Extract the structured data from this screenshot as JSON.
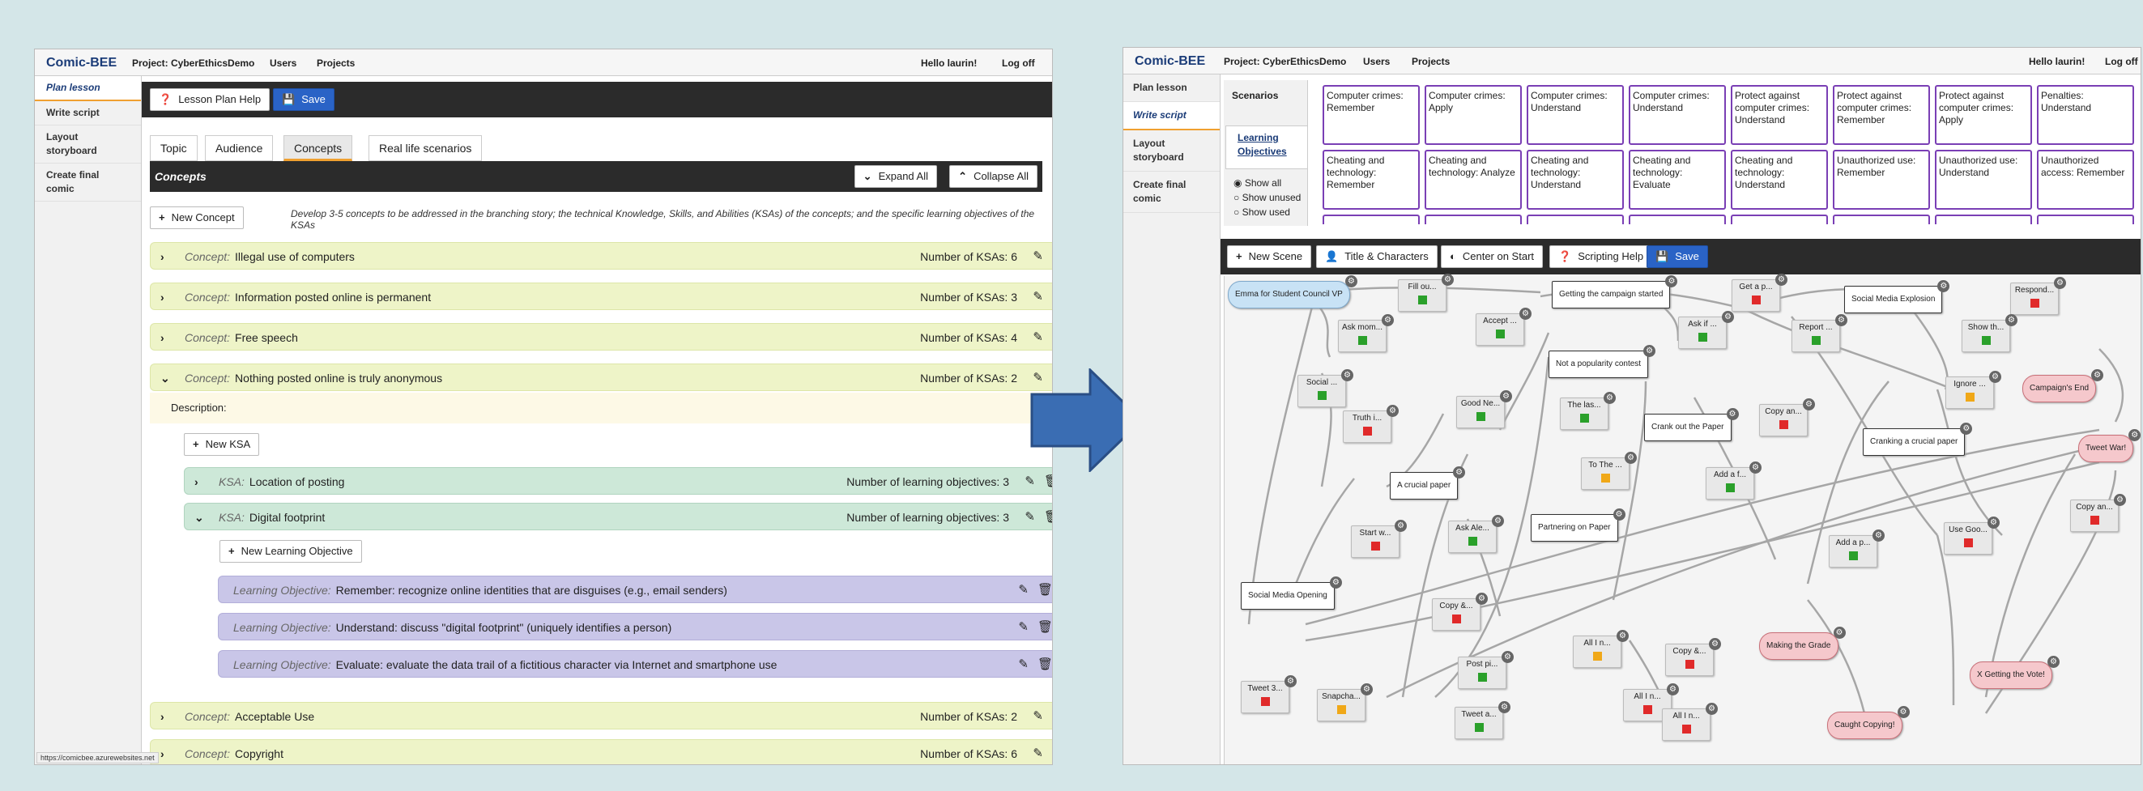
{
  "colors": {
    "accent": "#2a63c6",
    "concept_row": "#eef4c8",
    "ksa_row": "#cde8d8",
    "lo_row": "#c9c6e8",
    "lo_border": "#7a3fb5",
    "end_node": "#f5c8cc",
    "start_node": "#c8e2f5"
  },
  "left": {
    "brand": "Comic-BEE",
    "project": "Project: CyberEthicsDemo",
    "users": "Users",
    "projects": "Projects",
    "hello": "Hello laurin!",
    "logoff": "Log off",
    "sidebar": [
      "Plan lesson",
      "Write script",
      "Layout storyboard",
      "Create final comic"
    ],
    "help_btn": "Lesson Plan Help",
    "save_btn": "Save",
    "tabs": [
      "Topic",
      "Audience",
      "Concepts",
      "Real life scenarios"
    ],
    "section_title": "Concepts",
    "expand_all": "Expand All",
    "collapse_all": "Collapse All",
    "new_concept": "New Concept",
    "instructions": "Develop 3-5 concepts to be addressed in the branching story; the technical Knowledge, Skills, and Abilities (KSAs) of the concepts; and the specific learning objectives of the KSAs",
    "concept_kind": "Concept:",
    "ksa_kind": "KSA:",
    "lo_kind": "Learning Objective:",
    "concepts": [
      {
        "name": "Illegal use of computers",
        "count": "Number of KSAs: 6"
      },
      {
        "name": "Information posted online is permanent",
        "count": "Number of KSAs: 3"
      },
      {
        "name": "Free speech",
        "count": "Number of KSAs: 4"
      },
      {
        "name": "Nothing posted online is truly anonymous",
        "count": "Number of KSAs: 2"
      },
      {
        "name": "Acceptable Use",
        "count": "Number of KSAs: 2"
      },
      {
        "name": "Copyright",
        "count": "Number of KSAs: 6"
      }
    ],
    "description_label": "Description:",
    "new_ksa": "New KSA",
    "ksas": [
      {
        "name": "Location of posting",
        "count": "Number of learning objectives: 3"
      },
      {
        "name": "Digital footprint",
        "count": "Number of learning objectives: 3"
      }
    ],
    "new_lo": "New Learning Objective",
    "objectives": [
      "Remember: recognize online identities that are disguises (e.g., email senders)",
      "Understand: discuss \"digital footprint\" (uniquely identifies a person)",
      "Evaluate: evaluate the data trail of a fictitious character via Internet and smartphone use"
    ],
    "status_url": "https://comicbee.azurewebsites.net"
  },
  "right": {
    "brand": "Comic-BEE",
    "project": "Project: CyberEthicsDemo",
    "users": "Users",
    "projects": "Projects",
    "hello": "Hello laurin!",
    "logoff": "Log off",
    "sidebar": [
      "Plan lesson",
      "Write script",
      "Layout storyboard",
      "Create final comic"
    ],
    "scenarios": "Scenarios",
    "lo_tab": "Learning Objectives",
    "radios": [
      "Show all",
      "Show unused",
      "Show used"
    ],
    "lo_cells_row1": [
      "Computer crimes: Remember",
      "Computer crimes: Apply",
      "Computer crimes: Understand",
      "Computer crimes: Understand",
      "Protect against computer crimes: Understand",
      "Protect against computer crimes: Remember",
      "Protect against computer crimes: Apply",
      "Penalties: Understand"
    ],
    "lo_cells_row2": [
      "Cheating and technology: Remember",
      "Cheating and technology: Analyze",
      "Cheating and technology: Understand",
      "Cheating and technology: Evaluate",
      "Cheating and technology: Understand",
      "Unauthorized use: Remember",
      "Unauthorized use: Understand",
      "Unauthorized access: Remember"
    ],
    "toolbar": {
      "new_scene": "New Scene",
      "title_chars": "Title & Characters",
      "center": "Center on Start",
      "help": "Scripting Help",
      "save": "Save"
    },
    "scenes": {
      "start": "Emma for Student Council VP",
      "campaign": "Getting the campaign started",
      "explosion": "Social Media Explosion",
      "contest": "Not a popularity contest",
      "crank": "Crank out the Paper",
      "cranking": "Cranking a crucial paper",
      "crucial": "A crucial paper",
      "partner": "Partnering on Paper",
      "opening": "Social Media Opening",
      "end1": "Campaign's End",
      "end2": "Tweet War!",
      "end3": "Making the Grade",
      "end4": "X Getting the Vote!",
      "end5": "Caught Copying!"
    },
    "mini": [
      "Fill ou...",
      "Get a p...",
      "Respond...",
      "Ask mom...",
      "Accept ...",
      "Ask if ...",
      "Report ...",
      "Show th...",
      "Social ...",
      "Truth i...",
      "Good Ne...",
      "The las...",
      "Copy an...",
      "Ignore ...",
      "To The ...",
      "Add a f...",
      "Copy an...",
      "Start w...",
      "Ask Ale...",
      "Add a p...",
      "Use Goo...",
      "Copy &...",
      "All I n...",
      "Copy &...",
      "Post pi...",
      "Tweet 3...",
      "Snapcha...",
      "All I n...",
      "Tweet a...",
      "All I n..."
    ]
  }
}
